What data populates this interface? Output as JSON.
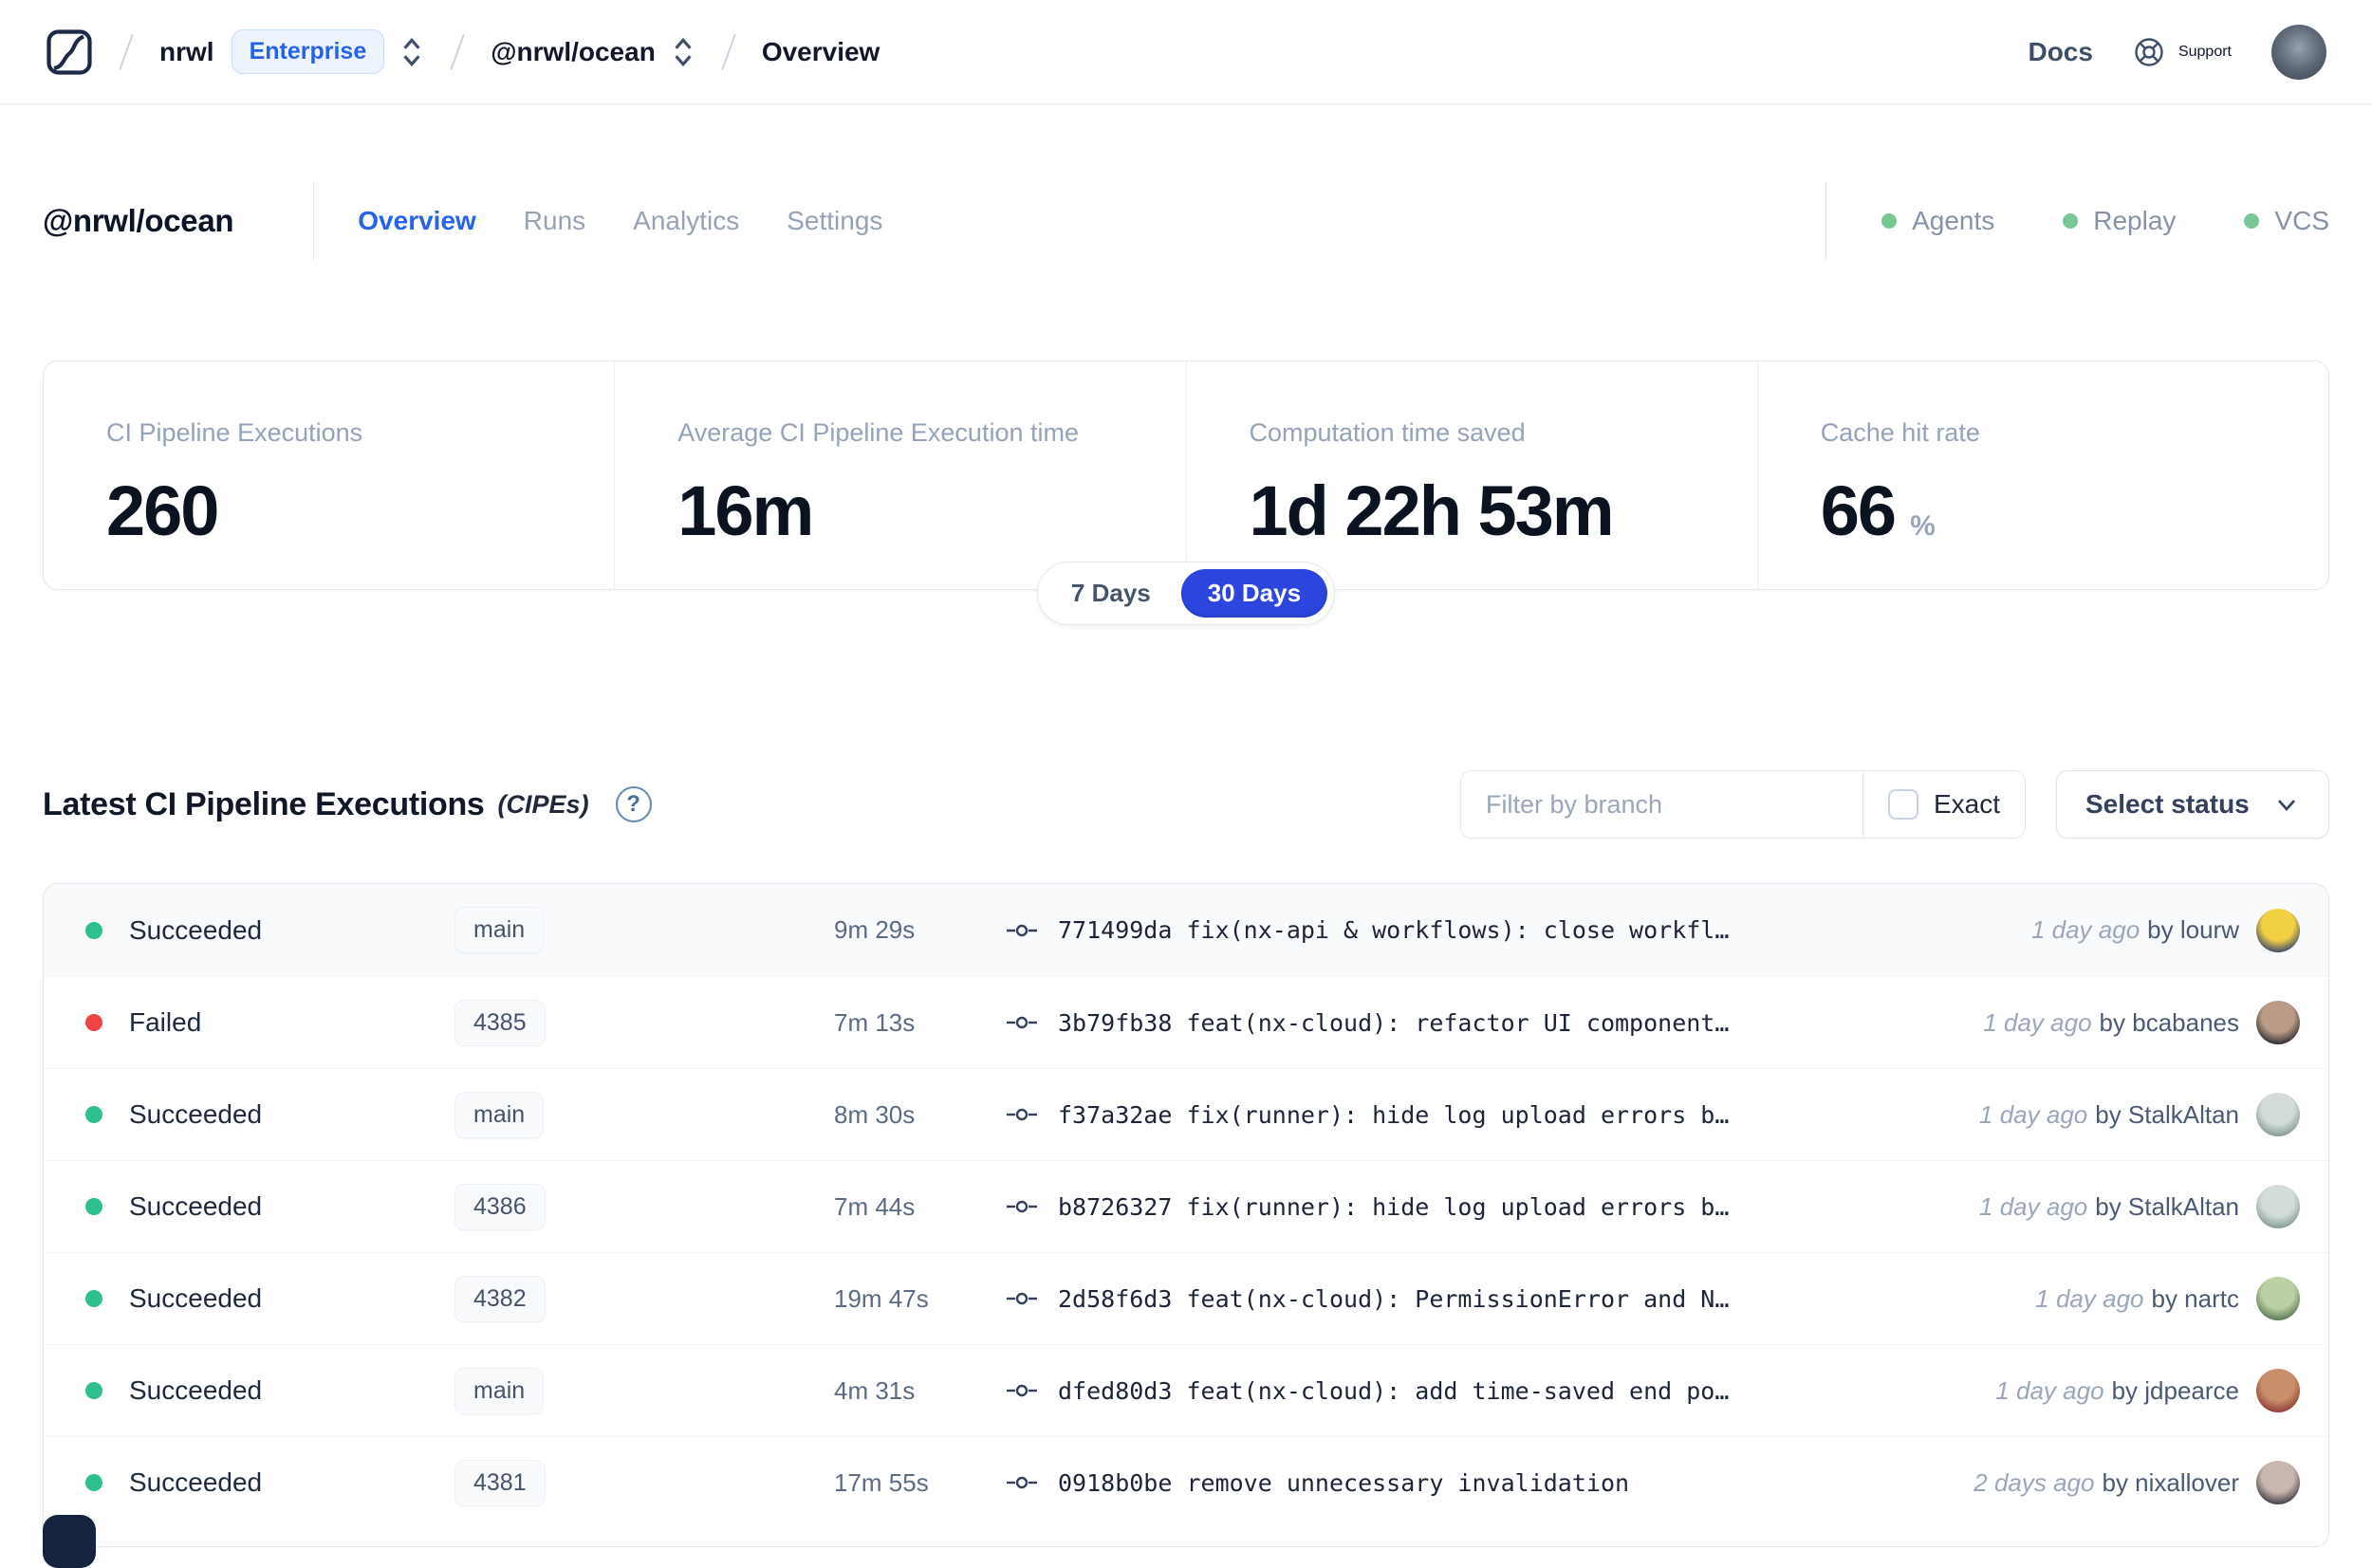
{
  "colors": {
    "accent_blue": "#2563eb",
    "selected_pill_blue": "#2b45dd",
    "success_green": "#2fbf8f",
    "failed_red": "#ef4444",
    "indicator_green": "#79c795"
  },
  "topbar": {
    "logo": "nx-cloud-logo",
    "org": {
      "name": "nrwl",
      "badge": "Enterprise"
    },
    "workspace": "@nrwl/ocean",
    "page": "Overview",
    "docs_label": "Docs",
    "support_label": "Support"
  },
  "workspace": {
    "title": "@nrwl/ocean",
    "tabs": [
      {
        "label": "Overview",
        "active": true
      },
      {
        "label": "Runs",
        "active": false
      },
      {
        "label": "Analytics",
        "active": false
      },
      {
        "label": "Settings",
        "active": false
      }
    ],
    "indicators": [
      {
        "label": "Agents"
      },
      {
        "label": "Replay"
      },
      {
        "label": "VCS"
      }
    ]
  },
  "stats": {
    "cards": [
      {
        "label": "CI Pipeline Executions",
        "value": "260",
        "suffix": ""
      },
      {
        "label": "Average CI Pipeline Execution time",
        "value": "16m",
        "suffix": ""
      },
      {
        "label": "Computation time saved",
        "value": "1d 22h 53m",
        "suffix": ""
      },
      {
        "label": "Cache hit rate",
        "value": "66",
        "suffix": "%"
      }
    ]
  },
  "range_toggle": {
    "options": [
      "7 Days",
      "30 Days"
    ],
    "selected": "30 Days"
  },
  "section": {
    "title": "Latest CI Pipeline Executions",
    "subtitle": "(CIPEs)",
    "help_icon": "?"
  },
  "filters": {
    "branch_placeholder": "Filter by branch",
    "exact_label": "Exact",
    "exact_checked": false,
    "status_label": "Select status"
  },
  "table": {
    "rows": [
      {
        "status": "Succeeded",
        "state": "success",
        "branch": "main",
        "duration": "9m 29s",
        "commit_hash": "771499da",
        "commit_message": "fix(nx-api & workflows): close workfl…",
        "time": "1 day ago",
        "author": "by lourw",
        "highlight": true,
        "avatar": {
          "from": "#f2d044",
          "to": "#31406e"
        }
      },
      {
        "status": "Failed",
        "state": "failed",
        "branch": "4385",
        "duration": "7m 13s",
        "commit_hash": "3b79fb38",
        "commit_message": "feat(nx-cloud): refactor UI component…",
        "time": "1 day ago",
        "author": "by bcabanes",
        "highlight": false,
        "avatar": {
          "from": "#bb9b85",
          "to": "#23252e"
        }
      },
      {
        "status": "Succeeded",
        "state": "success",
        "branch": "main",
        "duration": "8m 30s",
        "commit_hash": "f37a32ae",
        "commit_message": "fix(runner): hide log upload errors b…",
        "time": "1 day ago",
        "author": "by StalkAltan",
        "highlight": false,
        "avatar": {
          "from": "#d3dcd8",
          "to": "#7e958f"
        }
      },
      {
        "status": "Succeeded",
        "state": "success",
        "branch": "4386",
        "duration": "7m 44s",
        "commit_hash": "b8726327",
        "commit_message": "fix(runner): hide log upload errors b…",
        "time": "1 day ago",
        "author": "by StalkAltan",
        "highlight": false,
        "avatar": {
          "from": "#d3dcd8",
          "to": "#7e958f"
        }
      },
      {
        "status": "Succeeded",
        "state": "success",
        "branch": "4382",
        "duration": "19m 47s",
        "commit_hash": "2d58f6d3",
        "commit_message": "feat(nx-cloud): PermissionError and N…",
        "time": "1 day ago",
        "author": "by nartc",
        "highlight": false,
        "avatar": {
          "from": "#bdd0a4",
          "to": "#51714f"
        }
      },
      {
        "status": "Succeeded",
        "state": "success",
        "branch": "main",
        "duration": "4m 31s",
        "commit_hash": "dfed80d3",
        "commit_message": "feat(nx-cloud): add time-saved end po…",
        "time": "1 day ago",
        "author": "by jdpearce",
        "highlight": false,
        "avatar": {
          "from": "#c98f6b",
          "to": "#8c3732"
        }
      },
      {
        "status": "Succeeded",
        "state": "success",
        "branch": "4381",
        "duration": "17m 55s",
        "commit_hash": "0918b0be",
        "commit_message": "remove unnecessary invalidation",
        "time": "2 days ago",
        "author": "by nixallover",
        "highlight": false,
        "avatar": {
          "from": "#c9b6ae",
          "to": "#35343c"
        }
      }
    ]
  }
}
